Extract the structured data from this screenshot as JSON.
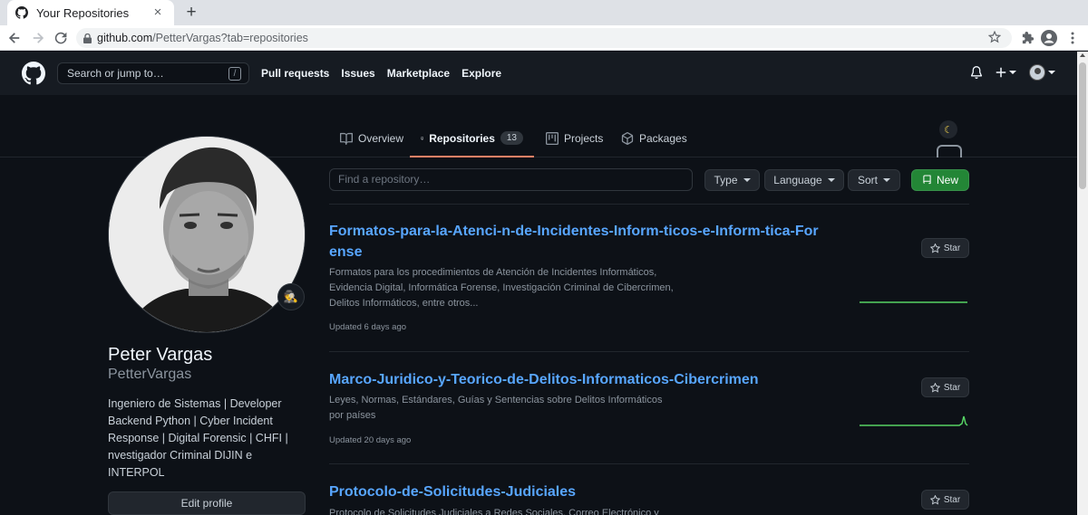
{
  "browser": {
    "tab_title": "Your Repositories",
    "url_host": "github.com",
    "url_path": "/PetterVargas?tab=repositories"
  },
  "header": {
    "search_placeholder": "Search or jump to…",
    "search_key": "/",
    "nav": [
      "Pull requests",
      "Issues",
      "Marketplace",
      "Explore"
    ],
    "icons": [
      "bell-icon",
      "plus-icon",
      "avatar"
    ]
  },
  "tabs": [
    {
      "label": "Overview",
      "icon": "book-icon"
    },
    {
      "label": "Repositories",
      "icon": "repo-icon",
      "count": "13",
      "selected": true
    },
    {
      "label": "Projects",
      "icon": "project-icon"
    },
    {
      "label": "Packages",
      "icon": "package-icon"
    }
  ],
  "profile": {
    "name": "Peter Vargas",
    "login": "PetterVargas",
    "bio": "Ingeniero de Sistemas | Developer Backend Python | Cyber Incident Response | Digital Forensic | CHFI | nvestigador Criminal DIJIN e INTERPOL",
    "edit_label": "Edit profile",
    "status_emoji": "🕵"
  },
  "filters": {
    "find_placeholder": "Find a repository…",
    "type_label": "Type",
    "language_label": "Language",
    "sort_label": "Sort",
    "new_label": "New"
  },
  "repos": [
    {
      "name": "Formatos-para-la-Atenci-n-de-Incidentes-Inform-ticos-e-Inform-tica-Forense",
      "description": "Formatos para los procedimientos de Atención de Incidentes Informáticos, Evidencia Digital, Informática Forense, Investigación Criminal de Cibercrimen, Delitos Informáticos, entre otros...",
      "updated": "Updated 6 days ago",
      "star_label": "Star"
    },
    {
      "name": "Marco-Juridico-y-Teorico-de-Delitos-Informaticos-Cibercrimen",
      "description": "Leyes, Normas, Estándares, Guías y Sentencias sobre Delitos Informáticos por países",
      "updated": "Updated 20 days ago",
      "star_label": "Star"
    },
    {
      "name": "Protocolo-de-Solicitudes-Judiciales",
      "description": "Protocolo de Solicitudes Judiciales a Redes Sociales, Correo Electrónico y",
      "updated": "",
      "star_label": "Star"
    }
  ],
  "colors": {
    "background": "#0d1117",
    "header": "#161b22",
    "link": "#58a6ff",
    "accent_tab": "#f78166",
    "new_button": "#238636",
    "sparkline": "#56d364"
  }
}
